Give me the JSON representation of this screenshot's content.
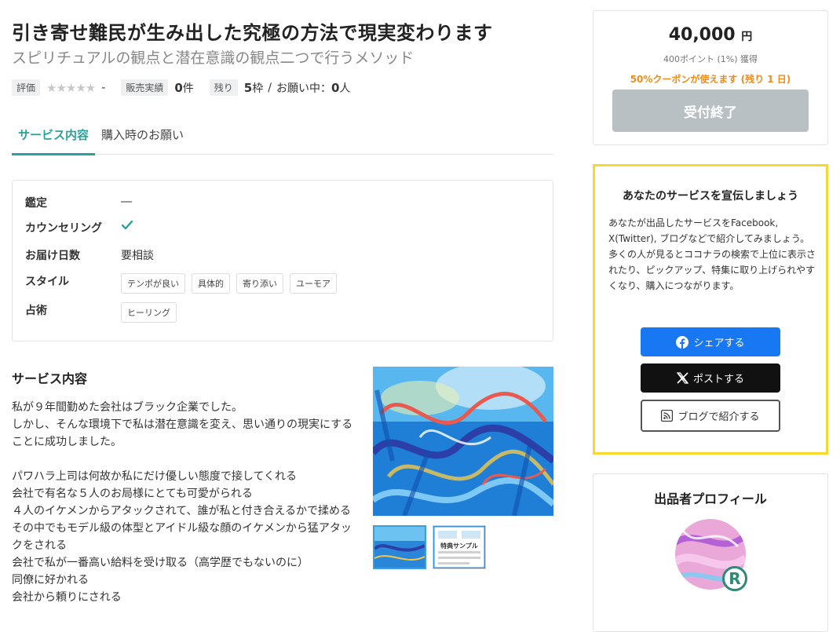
{
  "header": {
    "title": "引き寄せ難民が生み出した究極の方法で現実変わります",
    "subtitle": "スピリチュアルの観点と潜在意識の観点二つで行うメソッド"
  },
  "meta": {
    "rating_label": "評価",
    "stars": "★★★★★",
    "rating_value": "-",
    "sales_label": "販売実績",
    "sales_count": "0",
    "sales_unit": "件",
    "remaining_label": "残り",
    "remaining_count": "5",
    "remaining_unit": "枠",
    "separator": "/",
    "requests_label": "お願い中：",
    "requests_count": "0",
    "requests_unit": "人"
  },
  "tabs": [
    {
      "label": "サービス内容",
      "active": true
    },
    {
      "label": "購入時のお願い",
      "active": false
    }
  ],
  "specs": {
    "appraisal_label": "鑑定",
    "counseling_label": "カウンセリング",
    "delivery_label": "お届け日数",
    "delivery_value": "要相談",
    "style_label": "スタイル",
    "style_chips": [
      "テンポが良い",
      "具体的",
      "寄り添い",
      "ユーモア"
    ],
    "divination_label": "占術",
    "divination_chips": [
      "ヒーリング"
    ]
  },
  "service": {
    "heading": "サービス内容",
    "lines": [
      "私が９年間勤めた会社はブラック企業でした。",
      "しかし、そんな環境下で私は潜在意識を変え、思い通りの現実にすることに成功しました。",
      "",
      "パワハラ上司は何故か私にだけ優しい態度で接してくれる",
      "会社で有名な５人のお局様にとても可愛がられる",
      "４人のイケメンからアタックされて、誰が私と付き合えるかで揉める",
      "その中でもモデル級の体型とアイドル級な顔のイケメンから猛アタックをされる",
      "会社で私が一番高い給料を受け取る（高学歴でもないのに）",
      "同僚に好かれる",
      "会社から頼りにされる"
    ],
    "thumb2_text": "特典サンプル"
  },
  "purchase": {
    "price": "40,000",
    "currency": "円",
    "points": "400ポイント (1%) 獲得",
    "coupon": "50%クーポンが使えます (残り 1 日)",
    "button_label": "受付終了"
  },
  "promo": {
    "title": "あなたのサービスを宣伝しましょう",
    "paragraph1": "あなたが出品したサービスをFacebook, X(Twitter), ブログなどで紹介してみましょう。",
    "paragraph2": "多くの人が見るとココナラの検索で上位に表示されたり、ピックアップ、特集に取り上げられやすくなり、購入につながります。",
    "facebook_label": "シェアする",
    "x_label": "ポストする",
    "blog_label": "ブログで紹介する"
  },
  "profile": {
    "title": "出品者プロフィール",
    "badge": "R"
  },
  "colors": {
    "accent": "#2aa29b",
    "coupon": "#f08c1c",
    "facebook": "#1877f2",
    "promo_border": "#f6d92c",
    "closed_button": "#b9c0c4"
  },
  "icons": [
    "star-icon",
    "dash-icon",
    "check-icon",
    "facebook-icon",
    "x-icon",
    "rss-icon"
  ]
}
